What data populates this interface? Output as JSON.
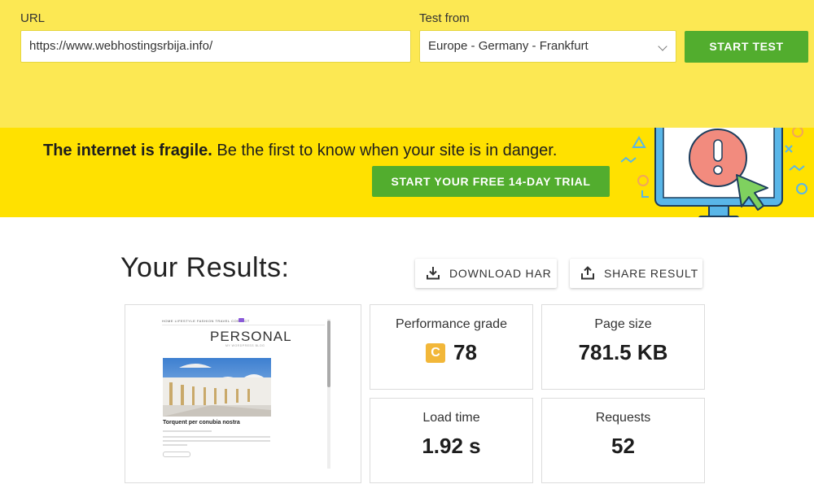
{
  "form": {
    "url_label": "URL",
    "url_value": "https://www.webhostingsrbija.info/",
    "test_from_label": "Test from",
    "test_from_value": "Europe - Germany - Frankfurt",
    "start_test_label": "START TEST"
  },
  "banner": {
    "headline_bold": "The internet is fragile.",
    "headline_rest": " Be the first to know when your site is in danger.",
    "trial_button": "START YOUR FREE 14-DAY TRIAL",
    "alert_glyph": "!"
  },
  "results": {
    "title": "Your Results:",
    "download_har_label": "DOWNLOAD HAR",
    "share_result_label": "SHARE RESULT",
    "performance_grade_label": "Performance grade",
    "grade_letter": "C",
    "grade_score": "78",
    "page_size_label": "Page size",
    "page_size_value": "781.5 KB",
    "load_time_label": "Load time",
    "load_time_value": "1.92 s",
    "requests_label": "Requests",
    "requests_value": "52"
  },
  "thumbnail": {
    "nav_items": "HOME   LIFESTYLE   FASHION   TRAVEL   CONTACT",
    "logo": "PERSONAL",
    "tagline": "MY WORDPRESS BLOG",
    "post_title": "Torquent per conubia nostra"
  },
  "colors": {
    "topbar_bg": "#fce853",
    "banner_bg": "#ffe100",
    "accent_green": "#52ad2e",
    "grade_badge": "#f2b739"
  },
  "icons": [
    "chevron-down-icon",
    "download-icon",
    "share-icon",
    "monitor-alert-illustration",
    "cursor-arrow-icon"
  ]
}
